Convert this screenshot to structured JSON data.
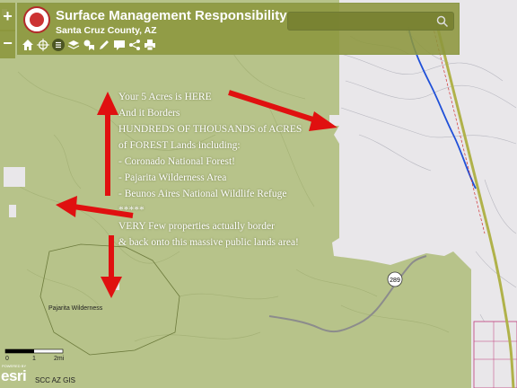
{
  "app": {
    "title": "Surface Management Responsibility",
    "subtitle": "Santa Cruz County, AZ"
  },
  "search": {
    "placeholder": ""
  },
  "toolbar": {
    "icons": [
      "home-icon",
      "locate-icon",
      "list-icon",
      "layers-icon",
      "bookmarks-icon",
      "edit-icon",
      "comment-icon",
      "share-icon",
      "print-icon"
    ]
  },
  "zoom": {
    "in_label": "+",
    "out_label": "−"
  },
  "annotation": {
    "lines": [
      "Your 5 Acres is HERE",
      "And it Borders",
      "HUNDREDS OF THOUSANDS of ACRES",
      "of FOREST Lands including:",
      "- Coronado National Forest!",
      "- Pajarita Wilderness Area",
      "- Beunos Aires National Wildlife Refuge",
      "*****",
      "VERY Few properties actually border",
      "& back onto this massive public lands area!"
    ]
  },
  "map": {
    "area_label": "Pajarita Wilderness",
    "route_label": "289",
    "scale": {
      "tick_0": "0",
      "tick_1": "1",
      "tick_2": "2mi"
    },
    "esri_label": "esri",
    "powered_by": "POWERED BY",
    "credit": "SCC AZ GIS"
  },
  "colors": {
    "forest": "#b7c38a",
    "private": "#e9e7ea",
    "arrow": "#e01010",
    "header": "#8c963c",
    "river": "#2050d8",
    "highway": "#b0b24a"
  }
}
